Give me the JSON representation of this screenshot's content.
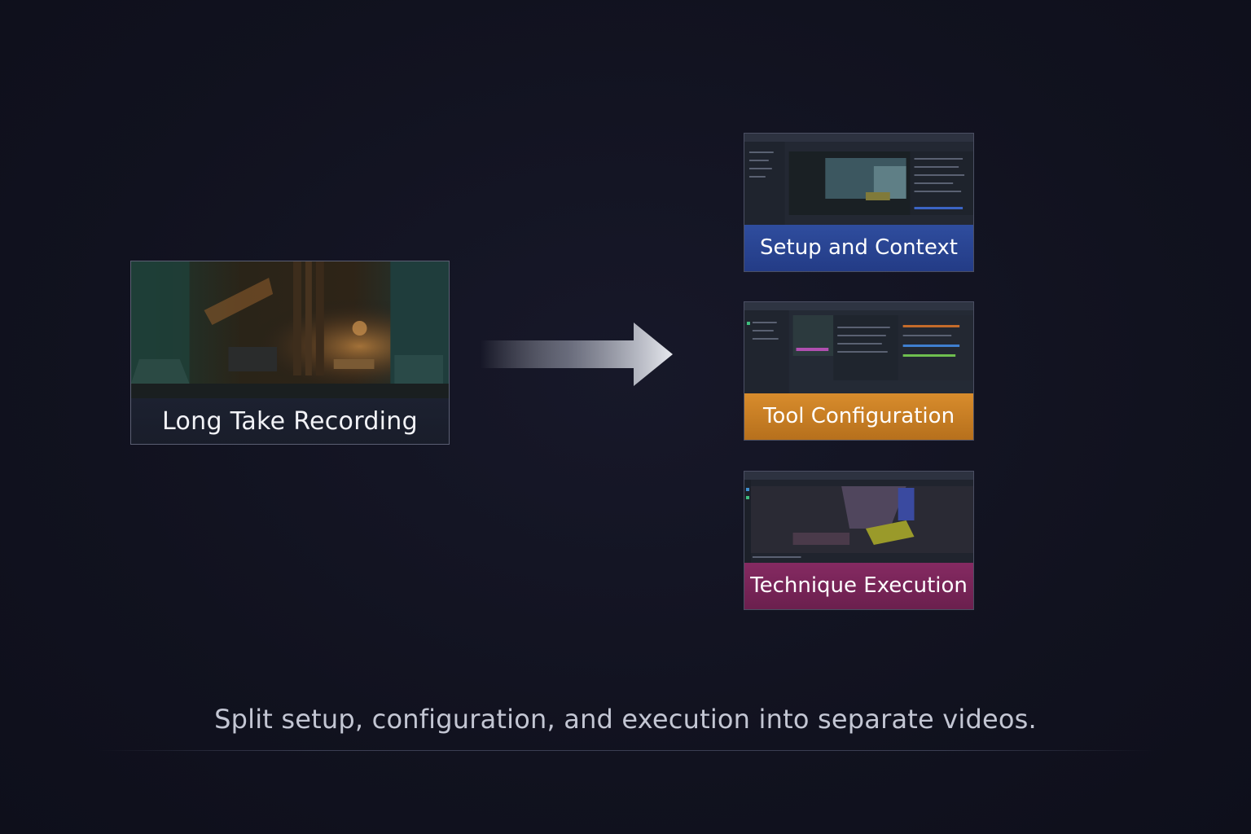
{
  "source": {
    "label": "Long Take Recording"
  },
  "outputs": [
    {
      "label": "Setup and Context",
      "color": "#2a4593"
    },
    {
      "label": "Tool Configuration",
      "color": "#c97d24"
    },
    {
      "label": "Technique Execution",
      "color": "#7a2558"
    }
  ],
  "caption": "Split setup, configuration, and execution into separate videos.",
  "colors": {
    "background": "#11121f",
    "arrow": "#d9dbe3",
    "caption_text": "#c3c6d3"
  }
}
